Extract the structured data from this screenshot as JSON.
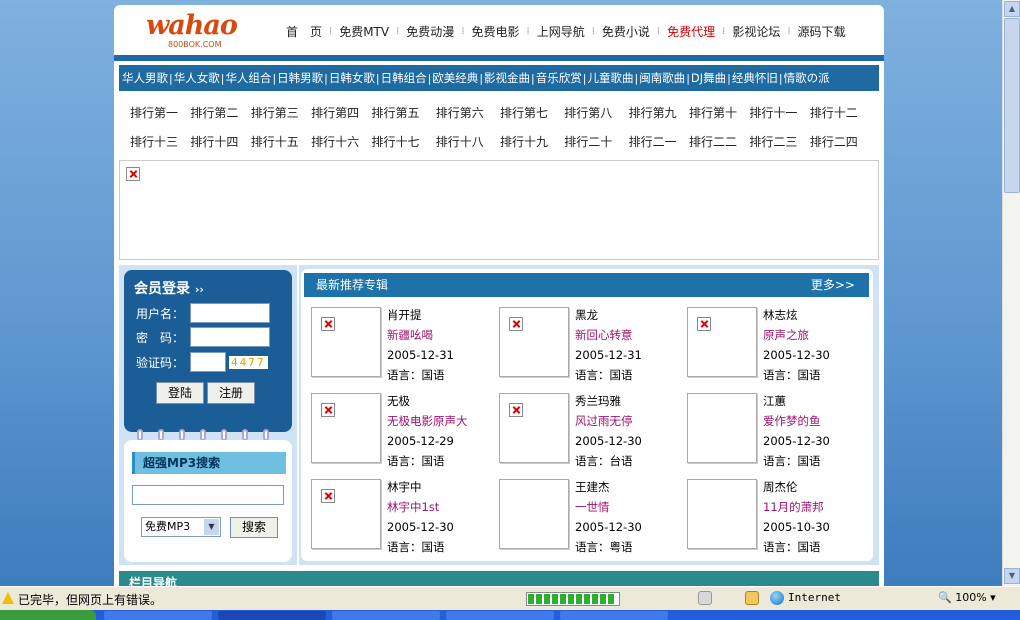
{
  "logo": {
    "main": "wahao",
    "sub": "800BOK.COM"
  },
  "topnav": [
    "首　页",
    "免费MTV",
    "免费动漫",
    "免费电影",
    "上网导航",
    "免费小说",
    "免费代理",
    "影视论坛",
    "源码下载"
  ],
  "topnav_hot_index": 6,
  "categories": [
    "华人男歌",
    "华人女歌",
    "华人组合",
    "日韩男歌",
    "日韩女歌",
    "日韩组合",
    "欧美经典",
    "影视金曲",
    "音乐欣赏",
    "儿童歌曲",
    "闽南歌曲",
    "DJ舞曲",
    "经典怀旧",
    "情歌の派"
  ],
  "rank_row1": [
    "排行第一",
    "排行第二",
    "排行第三",
    "排行第四",
    "排行第五",
    "排行第六",
    "排行第七",
    "排行第八",
    "排行第九",
    "排行第十",
    "排行十一",
    "排行十二"
  ],
  "rank_row2": [
    "排行十三",
    "排行十四",
    "排行十五",
    "排行十六",
    "排行十七",
    "排行十八",
    "排行十九",
    "排行二十",
    "排行二一",
    "排行二二",
    "排行二三",
    "排行二四"
  ],
  "login": {
    "title": "会员登录",
    "title_arrows": "››",
    "username_label": "用户名：",
    "password_label": "密　码：",
    "captcha_label": "验证码：",
    "captcha_code": "4477",
    "login_btn": "登陆",
    "register_btn": "注册"
  },
  "search": {
    "title": "超强MP3搜索",
    "input_value": "",
    "select_value": "免费MP3",
    "button": "搜索"
  },
  "albums_section": {
    "title": "最新推荐专辑",
    "more": "更多>>"
  },
  "albums": [
    {
      "artist": "肖开提",
      "title": "新疆吆喝",
      "date": "2005-12-31",
      "lang": "语言：国语",
      "broken": true
    },
    {
      "artist": "黑龙",
      "title": "新回心转意",
      "date": "2005-12-31",
      "lang": "语言：国语",
      "broken": true
    },
    {
      "artist": "林志炫",
      "title": "原声之旅",
      "date": "2005-12-30",
      "lang": "语言：国语",
      "broken": true
    },
    {
      "artist": "无极",
      "title": "无极电影原声大",
      "date": "2005-12-29",
      "lang": "语言：国语",
      "broken": true
    },
    {
      "artist": "秀兰玛雅",
      "title": "风过雨无停",
      "date": "2005-12-30",
      "lang": "语言：台语",
      "broken": true
    },
    {
      "artist": "江蕙",
      "title": "爱作梦的鱼",
      "date": "2005-12-30",
      "lang": "语言：国语",
      "broken": false
    },
    {
      "artist": "林宇中",
      "title": "林宇中1st",
      "date": "2005-12-30",
      "lang": "语言：国语",
      "broken": true
    },
    {
      "artist": "王建杰",
      "title": "一世情",
      "date": "2005-12-30",
      "lang": "语言：粤语",
      "broken": false
    },
    {
      "artist": "周杰伦",
      "title": "11月的萧邦",
      "date": "2005-10-30",
      "lang": "语言：国语",
      "broken": false
    }
  ],
  "bottom_section_title": "栏目导航",
  "statusbar": {
    "text": "已完毕，但网页上有错误。",
    "progress": 1.0,
    "zone": "Internet",
    "zoom": "100%"
  },
  "colors": {
    "nav_hot": "#d40000",
    "category_bg": "#1f6aa1",
    "album_title": "#a0136f",
    "page_bg": "#5c95cf"
  }
}
